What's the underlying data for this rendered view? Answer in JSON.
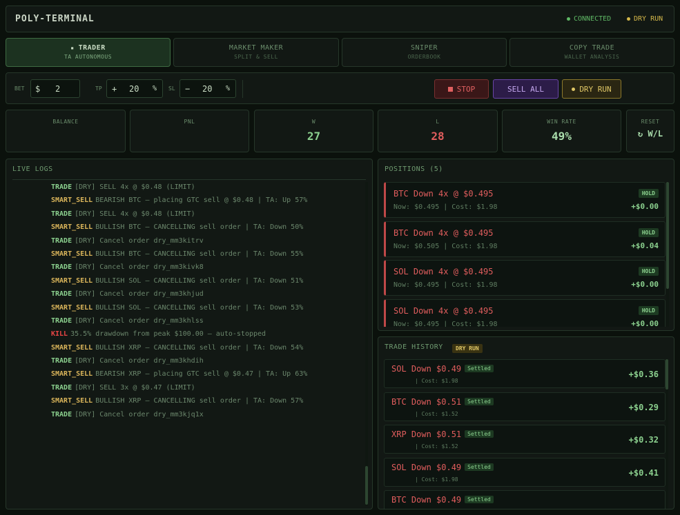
{
  "header": {
    "title": "POLY-TERMINAL",
    "connected_label": "CONNECTED",
    "dryrun_label": "DRY RUN",
    "connected_color": "#5fb865",
    "dryrun_color": "#d4b84a"
  },
  "tabs": [
    {
      "label": "TRADER",
      "sub": "TA AUTONOMOUS",
      "active": true
    },
    {
      "label": "MARKET MAKER",
      "sub": "SPLIT & SELL",
      "active": false
    },
    {
      "label": "SNIPER",
      "sub": "ORDERBOOK",
      "active": false
    },
    {
      "label": "COPY TRADE",
      "sub": "WALLET ANALYSIS",
      "active": false
    }
  ],
  "controls": {
    "bet_label": "BET",
    "bet_prefix": "$",
    "bet_value": "2",
    "tp_label": "TP",
    "tp_prefix": "+",
    "tp_value": "20",
    "tp_suffix": "%",
    "sl_label": "SL",
    "sl_prefix": "−",
    "sl_value": "20",
    "sl_suffix": "%",
    "stop_label": "STOP",
    "sellall_label": "SELL ALL",
    "dryrun_label": "DRY RUN"
  },
  "stats": {
    "balance_label": "BALANCE",
    "balance_value": "",
    "pnl_label": "PNL",
    "pnl_value": "",
    "w_label": "W",
    "w_value": "27",
    "l_label": "L",
    "l_value": "28",
    "winrate_label": "WIN RATE",
    "winrate_value": "49%",
    "reset_label": "RESET",
    "reset_value": "W/L"
  },
  "logs": {
    "title": "LIVE LOGS",
    "lines": [
      {
        "tag": "TRADE",
        "text": "[DRY] SELL 4x @ $0.48 (LIMIT)"
      },
      {
        "tag": "SMART_SELL",
        "text": "BEARISH BTC — placing GTC sell @ $0.48 | TA: Up 57%"
      },
      {
        "tag": "TRADE",
        "text": "[DRY] SELL 4x @ $0.48 (LIMIT)"
      },
      {
        "tag": "SMART_SELL",
        "text": "BULLISH BTC — CANCELLING sell order | TA: Down 50%"
      },
      {
        "tag": "TRADE",
        "text": "[DRY] Cancel order dry_mm3kitrv"
      },
      {
        "tag": "SMART_SELL",
        "text": "BULLISH BTC — CANCELLING sell order | TA: Down 55%"
      },
      {
        "tag": "TRADE",
        "text": "[DRY] Cancel order dry_mm3kivk8"
      },
      {
        "tag": "SMART_SELL",
        "text": "BULLISH SOL — CANCELLING sell order | TA: Down 51%"
      },
      {
        "tag": "TRADE",
        "text": "[DRY] Cancel order dry_mm3khjud"
      },
      {
        "tag": "SMART_SELL",
        "text": "BULLISH SOL — CANCELLING sell order | TA: Down 53%"
      },
      {
        "tag": "TRADE",
        "text": "[DRY] Cancel order dry_mm3khlss"
      },
      {
        "tag": "KILL",
        "text": "35.5% drawdown from peak $100.00 — auto-stopped"
      },
      {
        "tag": "SMART_SELL",
        "text": "BULLISH XRP — CANCELLING sell order | TA: Down 54%"
      },
      {
        "tag": "TRADE",
        "text": "[DRY] Cancel order dry_mm3khdih"
      },
      {
        "tag": "SMART_SELL",
        "text": "BEARISH XRP — placing GTC sell @ $0.47 | TA: Up 63%"
      },
      {
        "tag": "TRADE",
        "text": "[DRY] SELL 3x @ $0.47 (LIMIT)"
      },
      {
        "tag": "SMART_SELL",
        "text": "BULLISH XRP — CANCELLING sell order | TA: Down 57%"
      },
      {
        "tag": "TRADE",
        "text": "[DRY] Cancel order dry_mm3kjq1x"
      }
    ]
  },
  "tag_colors": {
    "TRADE": "#8bd08e",
    "SMART_SELL": "#d9b45a",
    "KILL": "#e84545"
  },
  "positions": {
    "title": "POSITIONS (5)",
    "items": [
      {
        "title": "BTC Down 4x @ $0.495",
        "now": "Now: $0.495 | Cost: $1.98",
        "badge": "HOLD",
        "pnl": "+$0.00"
      },
      {
        "title": "BTC Down 4x @ $0.495",
        "now": "Now: $0.505 | Cost: $1.98",
        "badge": "HOLD",
        "pnl": "+$0.04"
      },
      {
        "title": "SOL Down 4x @ $0.495",
        "now": "Now: $0.495 | Cost: $1.98",
        "badge": "HOLD",
        "pnl": "+$0.00"
      },
      {
        "title": "SOL Down 4x @ $0.495",
        "now": "Now: $0.495 | Cost: $1.98",
        "badge": "HOLD",
        "pnl": "+$0.00"
      }
    ]
  },
  "history": {
    "title": "TRADE HISTORY",
    "badge": "DRY RUN",
    "items": [
      {
        "title": "SOL Down $0.49",
        "status": "Settled",
        "cost": "| Cost: $1.98",
        "pnl": "+$0.36"
      },
      {
        "title": "BTC Down $0.51",
        "status": "Settled",
        "cost": "| Cost: $1.52",
        "pnl": "+$0.29"
      },
      {
        "title": "XRP Down $0.51",
        "status": "Settled",
        "cost": "| Cost: $1.52",
        "pnl": "+$0.32"
      },
      {
        "title": "SOL Down $0.49",
        "status": "Settled",
        "cost": "| Cost: $1.98",
        "pnl": "+$0.41"
      },
      {
        "title": "BTC Down $0.49",
        "status": "Settled",
        "cost": "",
        "pnl": ""
      }
    ]
  },
  "colors": {
    "positive": "#8bd08e",
    "negative": "#e05d5d"
  }
}
